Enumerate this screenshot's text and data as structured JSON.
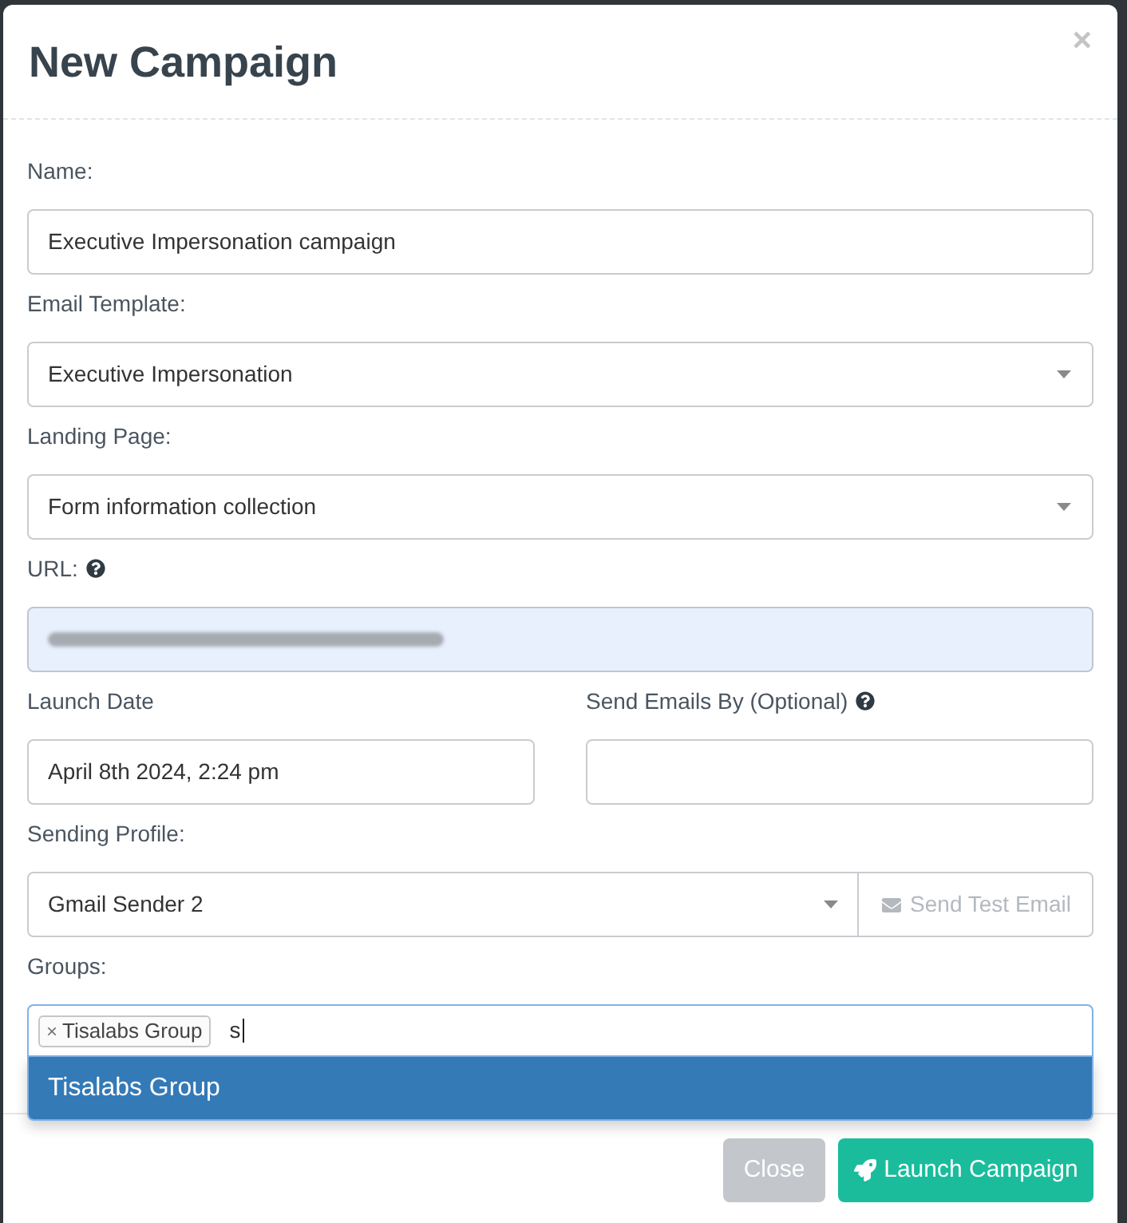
{
  "dialog": {
    "title": "New Campaign",
    "close": "×"
  },
  "fields": [
    {
      "kind": "text",
      "label": "Name:",
      "value": "Executive Impersonation campaign"
    },
    {
      "kind": "select",
      "label": "Email Template:",
      "value": "Executive Impersonation"
    },
    {
      "kind": "select",
      "label": "Landing Page:",
      "value": "Form information collection"
    },
    {
      "kind": "readonly",
      "label": "URL:",
      "help": true
    },
    {
      "kind": "pair",
      "items": [
        {
          "kind": "text",
          "label": "Launch Date",
          "value": "April 8th 2024, 2:24 pm"
        },
        {
          "kind": "text",
          "label": "Send Emails By (Optional)",
          "help": true
        }
      ]
    },
    {
      "kind": "select_button",
      "label": "Sending Profile:",
      "value": "Gmail Sender 2",
      "button": {
        "label": "Send Test Email",
        "disabled": true
      }
    },
    {
      "kind": "tags",
      "label": "Groups:",
      "focused": true,
      "tags": [
        {
          "remove": "×",
          "label": "Tisalabs Group"
        }
      ],
      "value": "s",
      "options": [
        {
          "label": "Tisalabs Group",
          "selected": true
        }
      ]
    }
  ],
  "footer": {
    "buttons": [
      {
        "kind": "secondary",
        "label": "Close"
      },
      {
        "kind": "primary",
        "label": "Launch Campaign"
      }
    ]
  }
}
